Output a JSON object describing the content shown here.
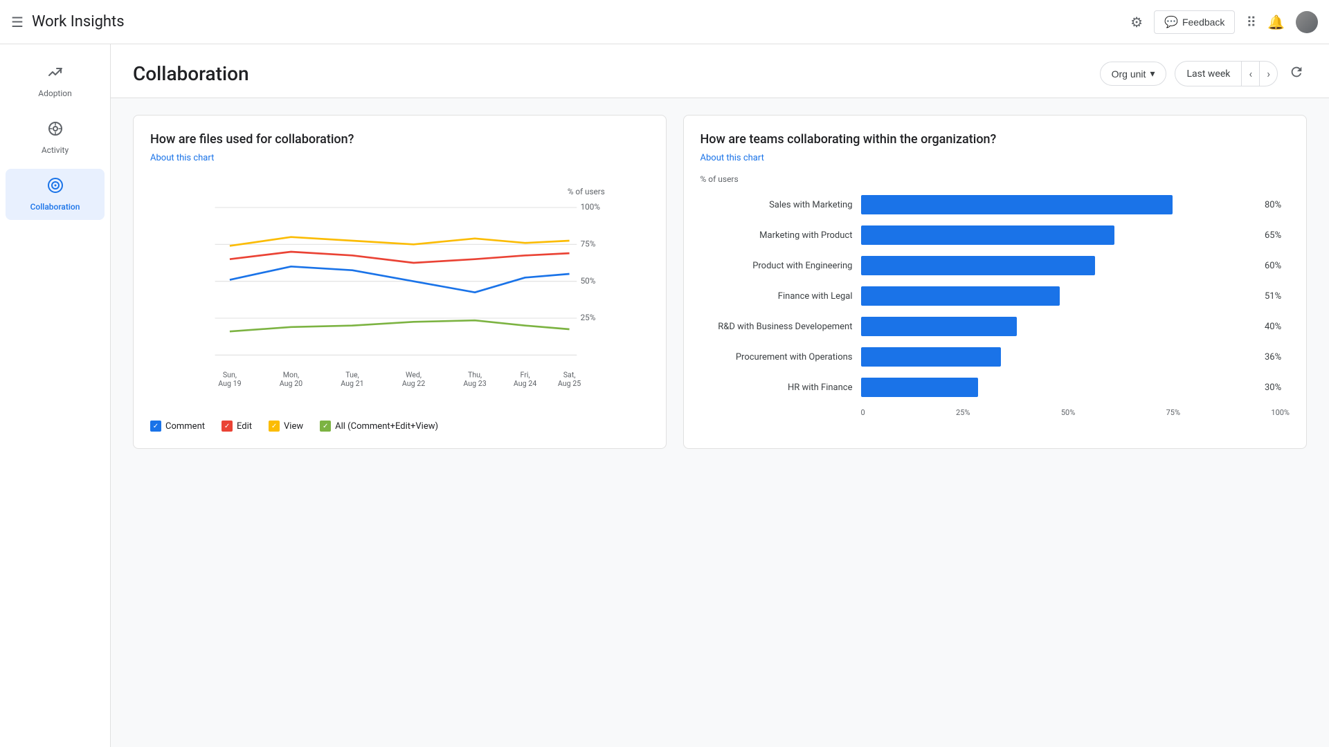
{
  "header": {
    "menu_icon": "☰",
    "title": "Work Insights",
    "feedback_label": "Feedback",
    "feedback_icon": "💬"
  },
  "sidebar": {
    "items": [
      {
        "id": "adoption",
        "label": "Adoption",
        "icon": "↗",
        "active": false
      },
      {
        "id": "activity",
        "label": "Activity",
        "icon": "↻",
        "active": false
      },
      {
        "id": "collaboration",
        "label": "Collaboration",
        "icon": "⊕",
        "active": true
      }
    ]
  },
  "page": {
    "title": "Collaboration",
    "org_unit_label": "Org unit",
    "date_label": "Last week"
  },
  "line_chart": {
    "title": "How are files used for collaboration?",
    "about_label": "About this chart",
    "y_label": "% of users",
    "x_labels": [
      {
        "line1": "Sun,",
        "line2": "Aug 19"
      },
      {
        "line1": "Mon,",
        "line2": "Aug 20"
      },
      {
        "line1": "Tue,",
        "line2": "Aug 21"
      },
      {
        "line1": "Wed,",
        "line2": "Aug 22"
      },
      {
        "line1": "Thu,",
        "line2": "Aug 23"
      },
      {
        "line1": "Fri,",
        "line2": "Aug 24"
      },
      {
        "line1": "Sat,",
        "line2": "Aug 25"
      }
    ],
    "y_ticks": [
      "100%",
      "75%",
      "50%",
      "25%"
    ],
    "legend": [
      {
        "label": "Comment",
        "color": "#1a73e8"
      },
      {
        "label": "Edit",
        "color": "#ea4335"
      },
      {
        "label": "View",
        "color": "#fbbc04"
      },
      {
        "label": "All (Comment+Edit+View)",
        "color": "#7cb342"
      }
    ]
  },
  "bar_chart": {
    "title": "How are teams collaborating within the organization?",
    "about_label": "About this chart",
    "y_label": "% of users",
    "x_ticks": [
      "0",
      "25%",
      "50%",
      "75%",
      "100%"
    ],
    "bars": [
      {
        "label": "Sales with Marketing",
        "value": 80
      },
      {
        "label": "Marketing with Product",
        "value": 65
      },
      {
        "label": "Product with Engineering",
        "value": 60
      },
      {
        "label": "Finance with Legal",
        "value": 51
      },
      {
        "label": "R&D with Business Developement",
        "value": 40
      },
      {
        "label": "Procurement with Operations",
        "value": 36
      },
      {
        "label": "HR with Finance",
        "value": 30
      }
    ]
  }
}
